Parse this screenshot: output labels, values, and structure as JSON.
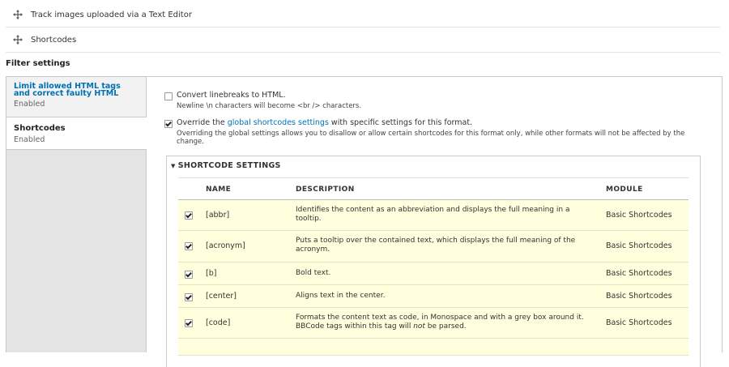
{
  "rows_top": [
    {
      "label": "Track images uploaded via a Text Editor"
    },
    {
      "label": "Shortcodes"
    }
  ],
  "section_title": "Filter settings",
  "vtabs": [
    {
      "title": "Limit allowed HTML tags and correct faulty HTML",
      "summary": "Enabled",
      "active": false
    },
    {
      "title": "Shortcodes",
      "summary": "Enabled",
      "active": true
    }
  ],
  "options": {
    "linebreaks": {
      "checked": false,
      "label": "Convert linebreaks to HTML.",
      "description": "Newline \\n characters will become <br  /> characters."
    },
    "override": {
      "checked": true,
      "label_before": "Override the ",
      "label_link": "global shortcodes settings",
      "label_after": " with specific settings for this format.",
      "description": "Overriding the global settings allows you to disallow or allow certain shortcodes for this format only, while other formats will not be affected by the change."
    }
  },
  "shortcode_settings": {
    "summary": "SHORTCODE SETTINGS",
    "columns": {
      "name": "NAME",
      "description": "DESCRIPTION",
      "module": "MODULE"
    },
    "rows": [
      {
        "checked": true,
        "name": "[abbr]",
        "description": "Identifies the content as an abbreviation and displays the full meaning in a tooltip.",
        "module": "Basic Shortcodes"
      },
      {
        "checked": true,
        "name": "[acronym]",
        "description": "Puts a tooltip over the contained text, which displays the full meaning of the acronym.",
        "module": "Basic Shortcodes"
      },
      {
        "checked": true,
        "name": "[b]",
        "description": "Bold text.",
        "module": "Basic Shortcodes"
      },
      {
        "checked": true,
        "name": "[center]",
        "description": "Aligns text in the center.",
        "module": "Basic Shortcodes"
      },
      {
        "checked": true,
        "name": "[code]",
        "description_before": "Formats the content text as code, in Monospace and with a grey box around it. BBCode tags within this tag will ",
        "description_em": "not",
        "description_after": " be parsed.",
        "module": "Basic Shortcodes"
      }
    ]
  }
}
